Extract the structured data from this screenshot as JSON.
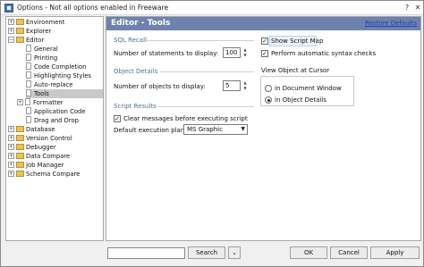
{
  "window": {
    "title": "Options - Not all options enabled in Freeware"
  },
  "tree": {
    "items": [
      {
        "label": "Environment",
        "expander": "+",
        "icon": "folder-icon"
      },
      {
        "label": "Explorer",
        "expander": "+",
        "icon": "folder-icon"
      },
      {
        "label": "Editor",
        "expander": "−",
        "icon": "folder-open-icon"
      },
      {
        "label": "General",
        "icon": "document-icon"
      },
      {
        "label": "Printing",
        "icon": "document-icon"
      },
      {
        "label": "Code Completion",
        "icon": "document-icon"
      },
      {
        "label": "Highlighting Styles",
        "icon": "document-icon"
      },
      {
        "label": "Auto-replace",
        "icon": "document-icon"
      },
      {
        "label": "Tools",
        "icon": "document-icon",
        "selected": true
      },
      {
        "label": "Formatter",
        "expander": "+",
        "icon": "document-icon"
      },
      {
        "label": "Application Code",
        "icon": "document-icon"
      },
      {
        "label": "Drag and Drop",
        "icon": "document-icon"
      },
      {
        "label": "Database",
        "expander": "+",
        "icon": "folder-icon"
      },
      {
        "label": "Version Control",
        "expander": "+",
        "icon": "folder-icon"
      },
      {
        "label": "Debugger",
        "expander": "+",
        "icon": "folder-icon"
      },
      {
        "label": "Data Compare",
        "expander": "+",
        "icon": "folder-icon"
      },
      {
        "label": "Job Manager",
        "expander": "+",
        "icon": "folder-icon"
      },
      {
        "label": "Schema Compare",
        "expander": "+",
        "icon": "folder-icon"
      }
    ]
  },
  "panel": {
    "title": "Editor - Tools",
    "restore_defaults": "Restore Defaults",
    "sql_recall": {
      "title": "SQL Recall",
      "statements_label": "Number of statements to display:",
      "statements_value": "100"
    },
    "object_details": {
      "title": "Object Details",
      "objects_label": "Number of objects to display:",
      "objects_value": "5"
    },
    "script_results": {
      "title": "Script Results",
      "clear_messages_label": "Clear messages before executing script",
      "clear_messages_checked": true,
      "plan_label": "Default execution plan:",
      "plan_value": "MS Graphic"
    },
    "show_script_map": {
      "label": "Show Script Map",
      "checked": true
    },
    "auto_syntax": {
      "label": "Perform automatic syntax checks",
      "checked": true
    },
    "view_object": {
      "title": "View Object at Cursor",
      "options": [
        {
          "label": "in Document Window",
          "selected": false
        },
        {
          "label": "in Object Details",
          "selected": true
        }
      ]
    }
  },
  "footer": {
    "search_value": "",
    "search_button": "Search",
    "ok_button": "OK",
    "cancel_button": "Cancel",
    "apply_button": "Apply"
  },
  "colors": {
    "header_bg": "#6d83ae",
    "link": "#1f3fb0",
    "group_title": "#556b94",
    "selection": "#c8c8c8"
  }
}
